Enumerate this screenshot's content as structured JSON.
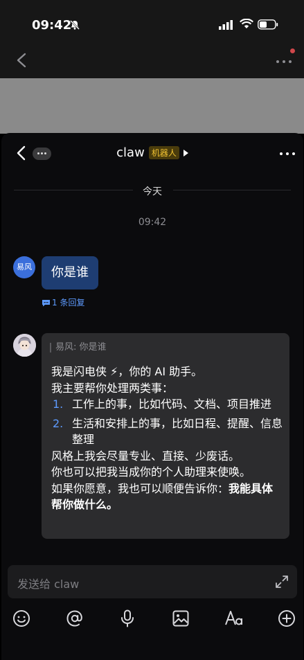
{
  "status_bar": {
    "time": "09:42"
  },
  "chat": {
    "title": "claw",
    "badge": "机器人",
    "date_divider": "今天",
    "timestamp": "09:42"
  },
  "messages": {
    "user": {
      "avatar_text": "易风",
      "text": "你是谁",
      "reply_count": "1 条回复"
    },
    "bot": {
      "quote": "易风: 你是谁",
      "line1": "我是闪电侠 ⚡，你的 AI 助手。",
      "line2": "我主要帮你处理两类事：",
      "items": [
        {
          "num": "1.",
          "text": "工作上的事，比如代码、文档、项目推进"
        },
        {
          "num": "2.",
          "text": "生活和安排上的事，比如日程、提醒、信息整理"
        }
      ],
      "line3": "风格上我会尽量专业、直接、少废话。",
      "line4": "你也可以把我当成你的个人助理来使唤。",
      "line5_prefix": "如果你愿意，我也可以顺便告诉你：",
      "line5_bold": "我能具体帮你做什么。"
    }
  },
  "input": {
    "placeholder": "发送给 claw"
  },
  "icons": {
    "toolbar": [
      "emoji-icon",
      "mention-icon",
      "microphone-icon",
      "image-icon",
      "font-icon",
      "plus-icon"
    ]
  }
}
